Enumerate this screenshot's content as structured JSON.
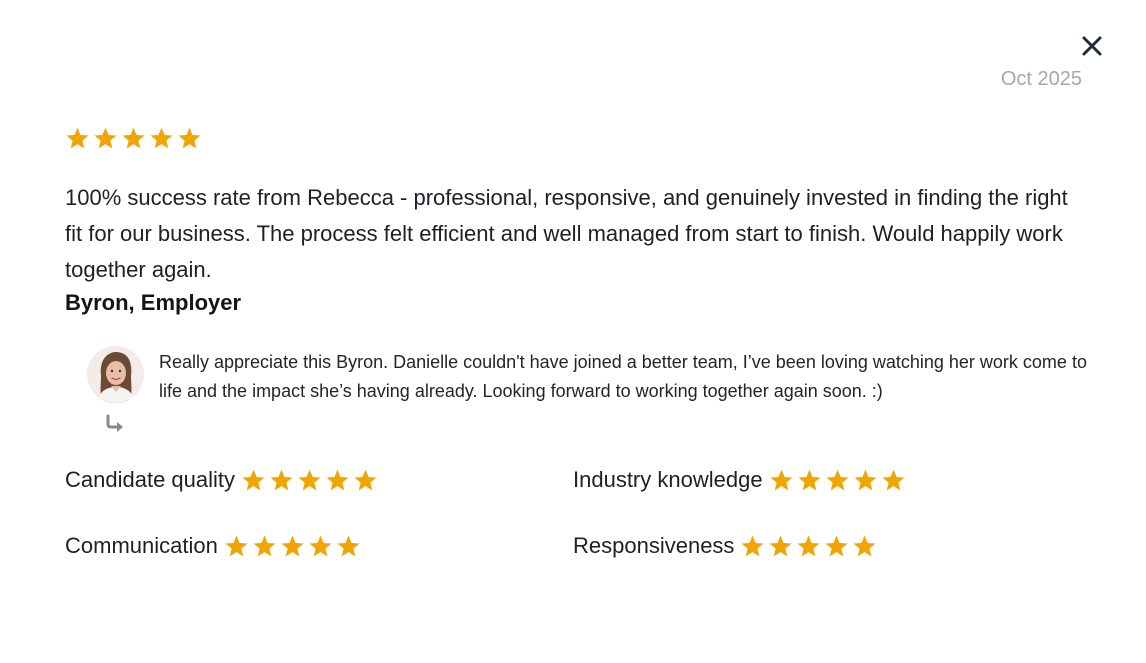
{
  "review": {
    "date": "Oct 2025",
    "rating": 5,
    "max_rating": 5,
    "text": "100% success rate from Rebecca - professional, responsive, and genuinely invested in finding the right fit for our business. The process felt efficient and well managed from start to finish. Would happily work together again.",
    "author": "Byron, Employer"
  },
  "reply": {
    "text": "Really appreciate this Byron. Danielle couldn't have joined a better team, I’ve been loving watching her work come to life and the impact she’s having already. Looking forward to working together again soon. :)"
  },
  "criteria": [
    {
      "label": "Candidate quality",
      "rating": 5
    },
    {
      "label": "Industry knowledge",
      "rating": 5
    },
    {
      "label": "Communication",
      "rating": 5
    },
    {
      "label": "Responsiveness",
      "rating": 5
    }
  ],
  "colors": {
    "star": "#f0a500",
    "close_icon": "#1d2b3a",
    "date": "#a3a8ad",
    "reply_arrow": "#8a8a8a"
  },
  "icons": {
    "close": "close-icon",
    "star": "star-icon",
    "reply": "reply-arrow-icon"
  }
}
